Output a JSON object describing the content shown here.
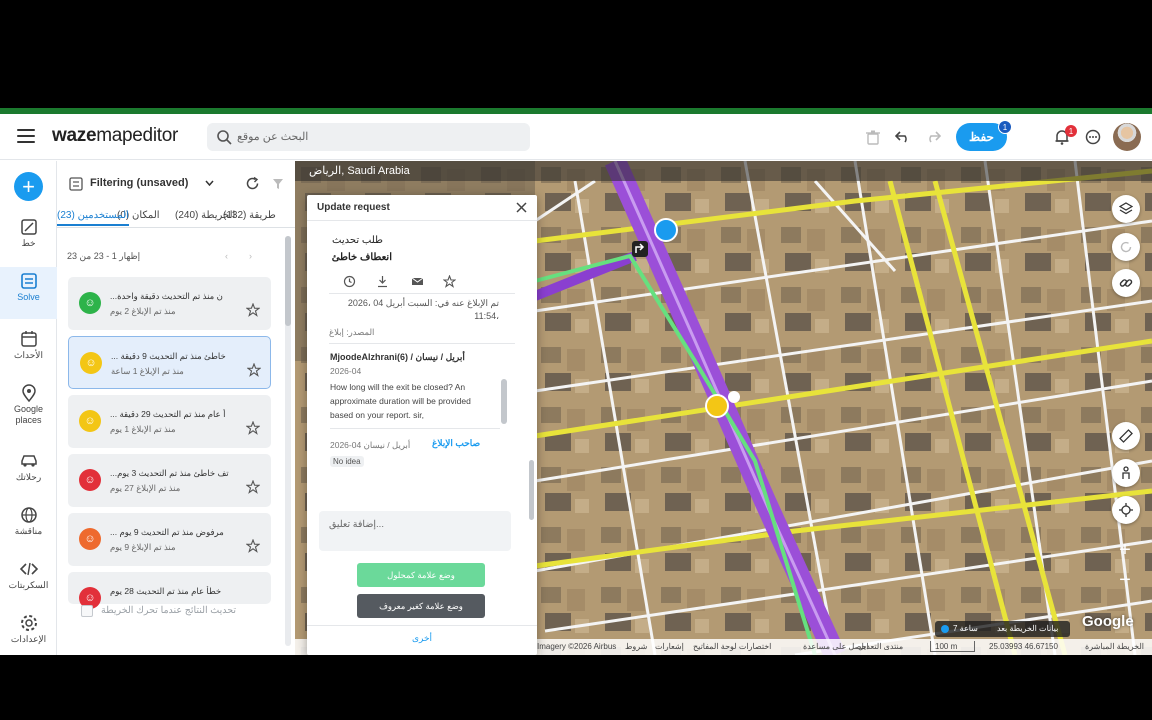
{
  "app": {
    "logo_bold": "waze",
    "logo_rest": "mapeditor",
    "search_placeholder": "البحث عن موقع",
    "save_label": "حفظ",
    "save_count": "1",
    "notif_count": "1"
  },
  "rail": [
    {
      "label": "خط",
      "icon": "draw-icon"
    },
    {
      "label": "Solve",
      "icon": "solve-icon",
      "active": true
    },
    {
      "label": "الأحداث",
      "icon": "calendar-icon"
    },
    {
      "label": "Google places",
      "icon": "place-pin-icon"
    },
    {
      "label": "رحلاتك",
      "icon": "car-icon"
    },
    {
      "label": "مناقشة",
      "icon": "globe-icon"
    },
    {
      "label": "السكربتات",
      "icon": "code-icon"
    },
    {
      "label": "الإعدادات",
      "icon": "gear-icon"
    }
  ],
  "panel": {
    "filter_label": "Filtering (unsaved)",
    "tabs": [
      "طريقة (132)",
      "الخريطة (240)",
      "المكان (0)",
      "المستخدمين (23)"
    ],
    "pager": "إظهار 1 - 23 من 23",
    "sync_label": "تحديث النتائج عندما تحرك الخريطة",
    "cards": [
      {
        "line1": "...ن منذ تم التحديث دقيقة واحدة",
        "line2": "منذ تم الإبلاغ 2 يوم",
        "color": "#2db34a"
      },
      {
        "line1": "... خاطئ منذ تم التحديث 9 دقيقة",
        "line2": "منذ تم الإبلاغ 1 ساعة",
        "color": "#f3c615"
      },
      {
        "line1": "... أ عام منذ تم التحديث 29 دقيقة",
        "line2": "منذ تم الإبلاغ 1 يوم",
        "color": "#f3c615"
      },
      {
        "line1": "...تف خاطئ منذ تم التحديث 3 يوم",
        "line2": "منذ تم الإبلاغ 27 يوم",
        "color": "#e2303a"
      },
      {
        "line1": "... مرفوض منذ تم التحديث 9 يوم",
        "line2": "منذ تم الإبلاغ 9 يوم",
        "color": "#ee6a2e"
      },
      {
        "line1": "خطأ عام منذ تم التحديث 28 يوم",
        "line2": "",
        "color": "#e2303a"
      }
    ]
  },
  "map": {
    "location": "الرياض, Saudi Arabia",
    "footer": {
      "image_credit": "Imagery ©2026 Airbus",
      "terms": "شروط",
      "privacy": "إشعارات",
      "shortcuts": "اختصارات لوحة المفاتيح",
      "help": "احصل على مساعدة",
      "feedback": "منتدى التعديل",
      "scale": "100 m",
      "coords": "25.03993 46.67150",
      "live_map": "الخريطة المباشرة"
    },
    "timepill": {
      "label": "بيانات الخريطة بعد",
      "value": "7 ساعة"
    },
    "google": "Google"
  },
  "dialog": {
    "title": "Update request",
    "type": "طلب تحديث",
    "subtype": "انعطاف خاطئ",
    "reported": "تم الإبلاغ عنه في: السبت أبريل 04 ،2026 ،11:54",
    "source": "المصدر: إبلاغ",
    "messages": [
      {
        "author": "MjoodeAlzhrani(6) / أبريل / نيسان",
        "date": "2026-04",
        "text": "How long will the exit be closed? An approximate duration will be provided based on your report. sir,"
      },
      {
        "author": "صاحب الإبلاغ",
        "date": "أبريل / نيسان 04-2026",
        "text": "No idea"
      }
    ],
    "comment_placeholder": "إضافة تعليق...",
    "btn_solved": "وضع علامة كمحلول",
    "btn_not_identified": "وضع علامة كغير معروف",
    "btn_other": "أخرى"
  }
}
